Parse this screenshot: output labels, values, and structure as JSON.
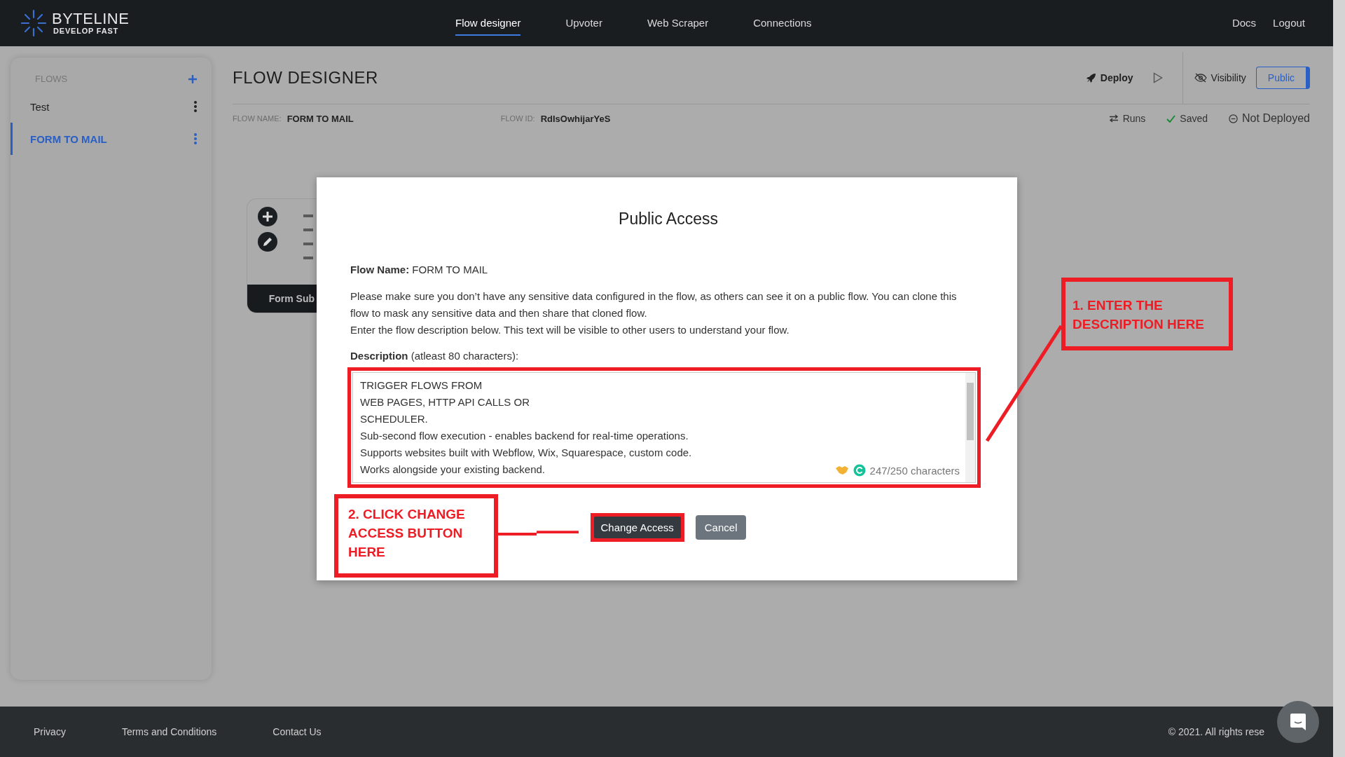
{
  "header": {
    "logo_name": "BYTELINE",
    "logo_tagline": "DEVELOP FAST",
    "nav": [
      {
        "label": "Flow designer",
        "selected": true
      },
      {
        "label": "Upvoter",
        "selected": false
      },
      {
        "label": "Web Scraper",
        "selected": false
      },
      {
        "label": "Connections",
        "selected": false
      }
    ],
    "right_links": [
      "Docs",
      "Logout"
    ]
  },
  "sidebar": {
    "title": "FLOWS",
    "items": [
      {
        "label": "Test",
        "selected": false
      },
      {
        "label": "FORM TO MAIL",
        "selected": true
      }
    ]
  },
  "page": {
    "title": "FLOW DESIGNER",
    "deploy": "Deploy",
    "visibility": "Visibility",
    "public_button": "Public",
    "flow_name_label": "FLOW NAME:",
    "flow_name": "FORM TO MAIL",
    "flow_id_label": "FLOW ID:",
    "flow_id": "RdIsOwhijarYeS",
    "runs": "Runs",
    "saved": "Saved",
    "deploy_status": "Not Deployed"
  },
  "canvas": {
    "node_label": "Form Sub"
  },
  "modal": {
    "title": "Public Access",
    "flow_name": "**Flow Name:** FORM TO MAIL",
    "paragraphs": [
      "Please make sure you don’t have any sensitive data configured in the flow, as others can see it on a public flow. You can clone this flow to mask any sensitive data and then share that cloned flow.",
      "Enter the flow description below. This text will be visible to other users to understand your flow."
    ],
    "description_label": "**Description** (atleast 80 characters):",
    "description_lines": [
      "TRIGGER FLOWS FROM",
      "WEB PAGES, HTTP API CALLS OR",
      "SCHEDULER.",
      "Sub-second flow execution - enables backend for real-time operations.",
      "Supports websites built with Webflow, Wix, Squarespace, custom code.",
      "Works alongside your existing backend."
    ],
    "counter": "247/250 characters",
    "primary_button": "Change Access",
    "secondary_button": "Cancel"
  },
  "annotations": [
    "1. ENTER THE DESCRIPTION HERE",
    "2. CLICK CHANGE ACCESS BUTTON HERE"
  ],
  "footer": {
    "links": [
      "Privacy",
      "Terms and Conditions",
      "Contact Us"
    ],
    "copyright": "© 2021. All rights rese"
  }
}
